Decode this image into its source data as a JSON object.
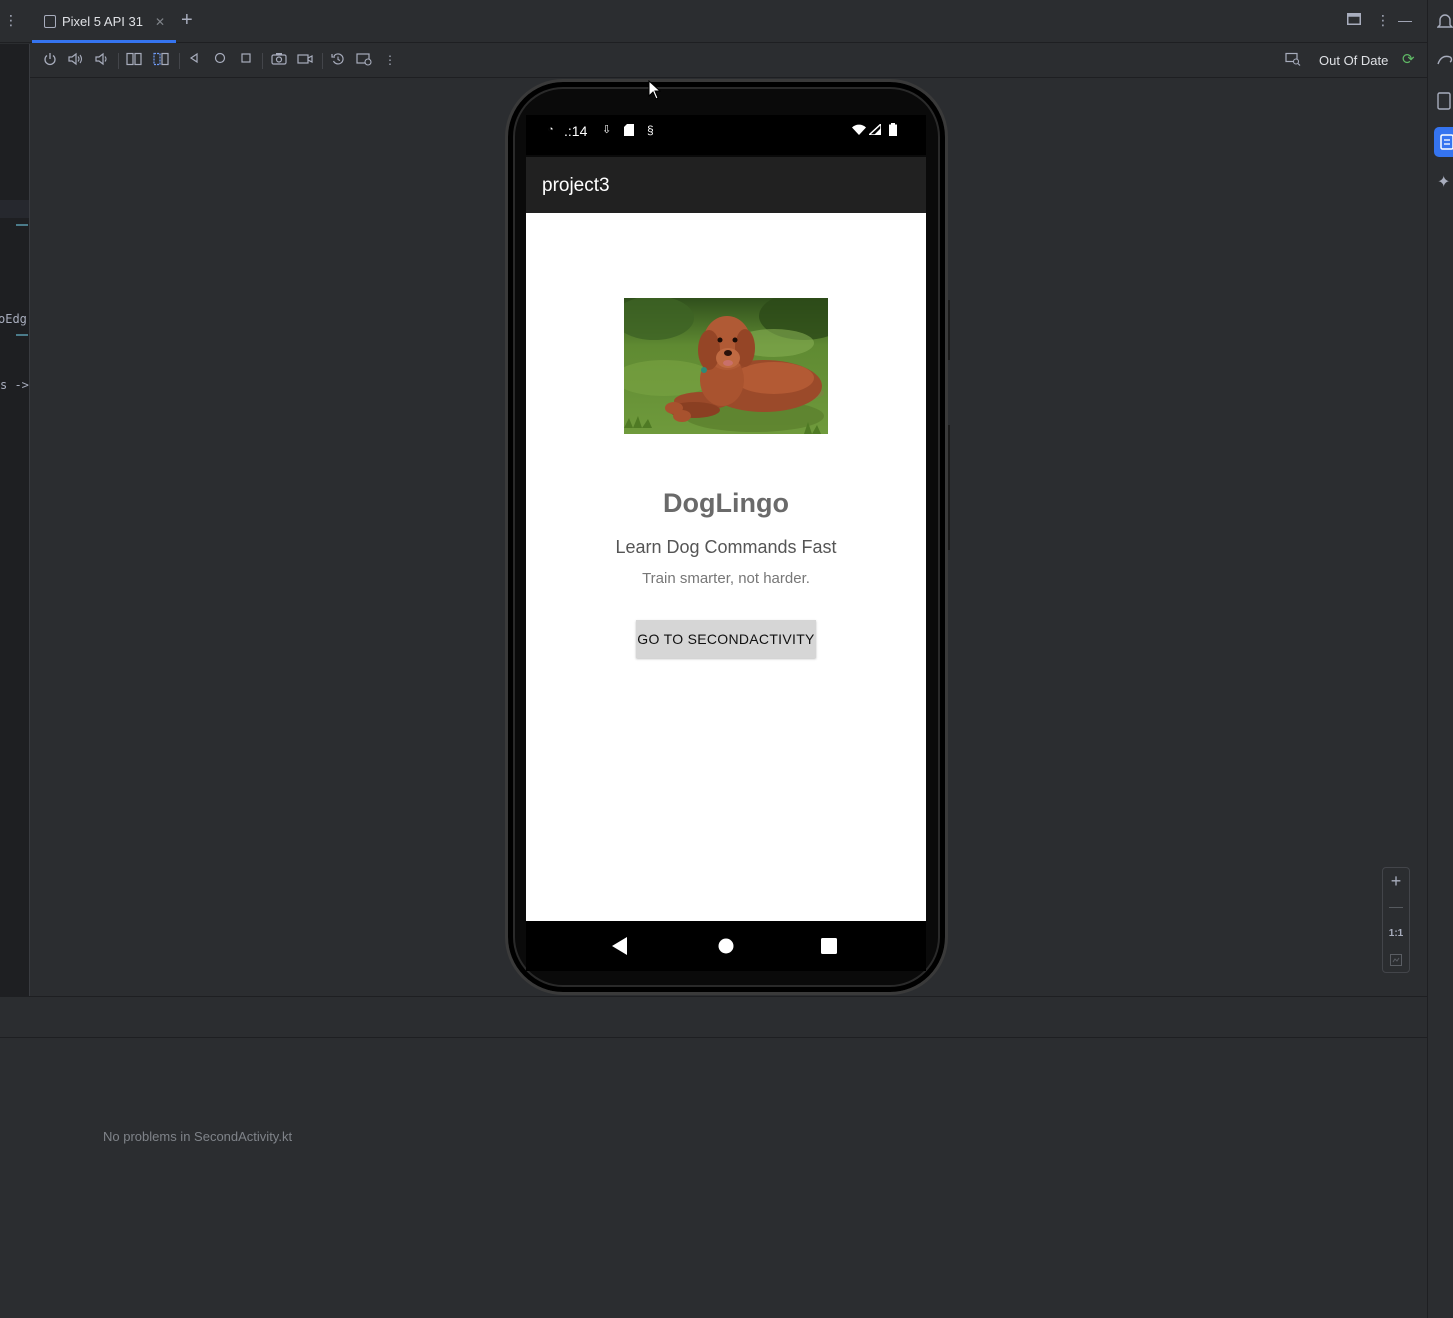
{
  "tabs": [
    {
      "label": "Pixel 5 API 31",
      "active": true
    }
  ],
  "toolbar": {
    "status_label": "Out Of Date",
    "buttons": [
      "power-icon",
      "volume-up-icon",
      "volume-down-icon",
      "rotate-left-icon",
      "rotate-right-icon",
      "back-icon",
      "home-icon",
      "overview-icon",
      "screenshot-icon",
      "screen-record-icon",
      "snapshot-icon",
      "extended-controls-icon",
      "more-icon"
    ]
  },
  "gutter": {
    "fragments": [
      "oEdg",
      "s ->"
    ]
  },
  "device": {
    "status_time": ".:14",
    "app_title": "project3",
    "headline": "DogLingo",
    "subhead": "Learn Dog Commands Fast",
    "tagline": "Train smarter, not harder.",
    "button_label": "GO TO SECONDACTIVITY",
    "image_subject": "dog lying on grass"
  },
  "zoom": {
    "one_to_one_label": "1:1"
  },
  "problems": {
    "message": "No problems in SecondActivity.kt"
  },
  "colors": {
    "accent": "#3574f0",
    "ok_green": "#5fb865",
    "ide_bg": "#2b2d30",
    "app_bar": "#212121"
  }
}
